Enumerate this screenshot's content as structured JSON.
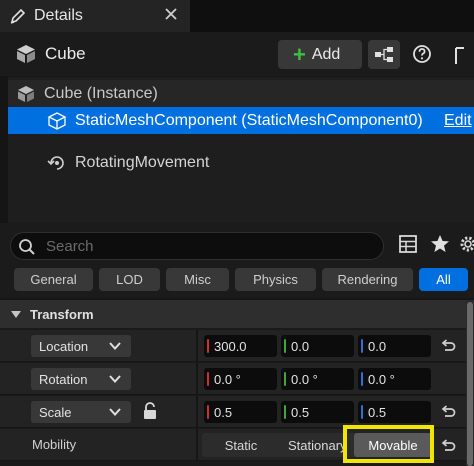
{
  "tab": {
    "title": "Details",
    "icon": "pencil-icon",
    "close_icon": "close-icon"
  },
  "header": {
    "actor_name": "Cube",
    "add_label": "Add",
    "accent": "#3fbf3f"
  },
  "tree": {
    "instance_label": "Cube (Instance)",
    "selected_label": "StaticMeshComponent (StaticMeshComponent0)",
    "edit_label": "Edit",
    "rotating_label": "RotatingMovement",
    "selection_color": "#0070e0"
  },
  "search": {
    "placeholder": "Search"
  },
  "filters": {
    "items": [
      "General",
      "LOD",
      "Misc",
      "Physics",
      "Rendering",
      "All"
    ],
    "active": "All"
  },
  "transform": {
    "section_title": "Transform",
    "location": {
      "label": "Location",
      "x": "300.0",
      "y": "0.0",
      "z": "0.0"
    },
    "rotation": {
      "label": "Rotation",
      "x": "0.0 °",
      "y": "0.0 °",
      "z": "0.0 °"
    },
    "scale": {
      "label": "Scale",
      "x": "0.5",
      "y": "0.5",
      "z": "0.5"
    },
    "axis_colors": {
      "x": "#c83232",
      "y": "#3ea83e",
      "z": "#2f6fd6"
    }
  },
  "mobility": {
    "label": "Mobility",
    "options": [
      "Static",
      "Stationary",
      "Movable"
    ],
    "selected": "Movable",
    "highlight_color": "#f2e600"
  }
}
